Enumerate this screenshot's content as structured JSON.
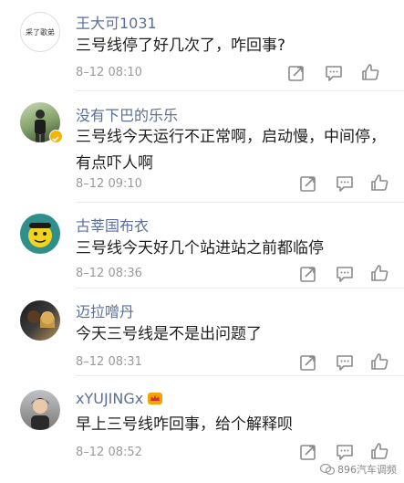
{
  "comments": [
    {
      "username": "王大可1031",
      "avatar_text": "采了歌弟",
      "text": "三号线停了好几次了，咋回事?",
      "time": "8–12 08:10",
      "text_lines": 1
    },
    {
      "username": "没有下巴的乐乐",
      "text": "三号线今天运行不正常啊，启动慢，中间停，有点吓人啊",
      "time": "8–12 09:10",
      "text_lines": 2
    },
    {
      "username": "古莘国布衣",
      "text": "三号线今天好几个站进站之前都临停",
      "time": "8–12 08:36",
      "text_lines": 1
    },
    {
      "username": "迈拉噌丹",
      "text": "今天三号线是不是出问题了",
      "time": "8–12 08:31",
      "text_lines": 1
    },
    {
      "username": "xYUJINGx",
      "text": "早上三号线咋回事，给个解释呗",
      "time": "8–12 08:52",
      "text_lines": 1
    }
  ],
  "actions": {
    "share_icon": "share-icon",
    "comment_icon": "comment-icon",
    "like_icon": "thumbs-up-icon"
  },
  "watermark": "896汽车调频",
  "colors": {
    "username": "#5b6f9a",
    "text": "#1f1f1f",
    "time": "#9a9a9a",
    "icon": "#8a8a8a"
  }
}
